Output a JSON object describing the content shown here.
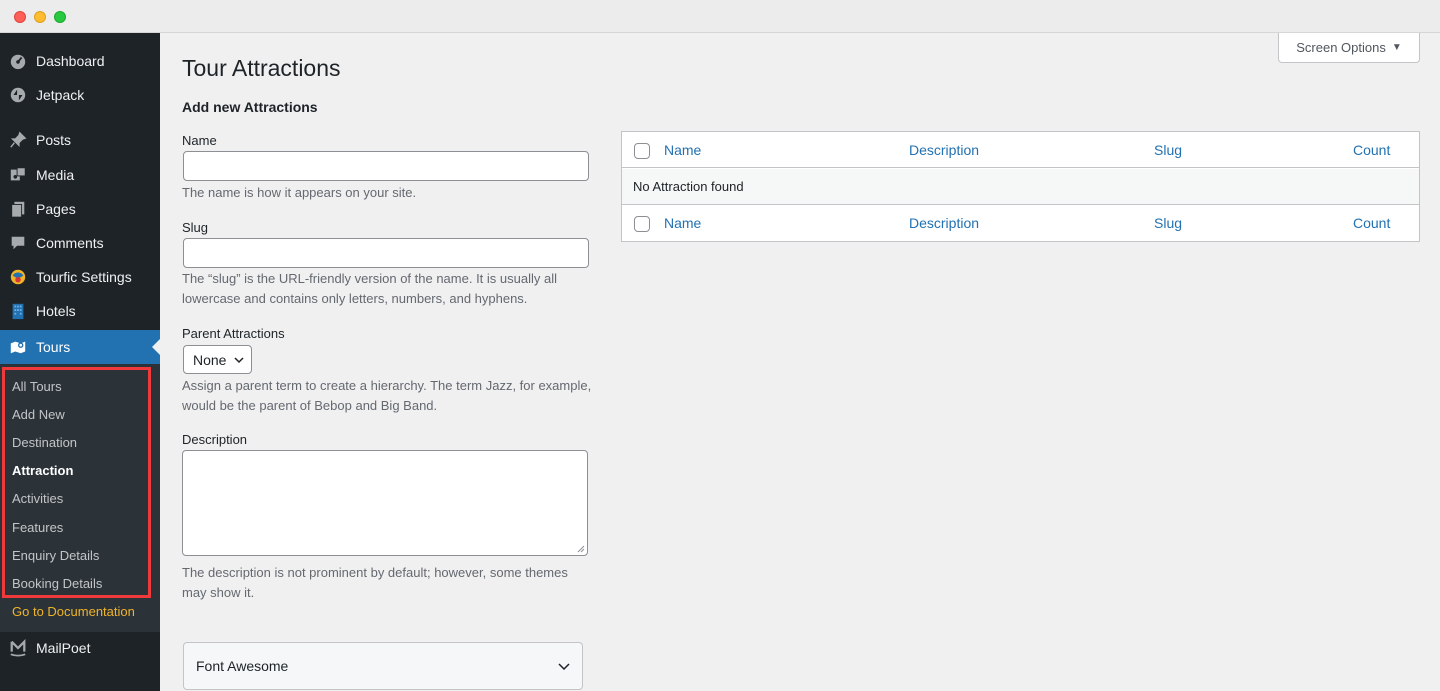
{
  "sidebar": {
    "items": [
      {
        "label": "Dashboard",
        "icon": "dashboard-icon"
      },
      {
        "label": "Jetpack",
        "icon": "jetpack-icon"
      },
      {
        "label": "Posts",
        "icon": "pin-icon"
      },
      {
        "label": "Media",
        "icon": "media-icon"
      },
      {
        "label": "Pages",
        "icon": "pages-icon"
      },
      {
        "label": "Comments",
        "icon": "comment-icon"
      },
      {
        "label": "Tourfic Settings",
        "icon": "tourfic-icon"
      },
      {
        "label": "Hotels",
        "icon": "building-icon"
      },
      {
        "label": "Tours",
        "icon": "map-icon"
      },
      {
        "label": "MailPoet",
        "icon": "mailpoet-icon"
      }
    ],
    "submenu": [
      {
        "label": "All Tours"
      },
      {
        "label": "Add New"
      },
      {
        "label": "Destination"
      },
      {
        "label": "Attraction"
      },
      {
        "label": "Activities"
      },
      {
        "label": "Features"
      },
      {
        "label": "Enquiry Details"
      },
      {
        "label": "Booking Details"
      },
      {
        "label": "Go to Documentation"
      }
    ]
  },
  "header": {
    "screen_options": "Screen Options"
  },
  "page": {
    "title": "Tour Attractions",
    "form_title": "Add new Attractions",
    "name_label": "Name",
    "name_value": "",
    "name_help": "The name is how it appears on your site.",
    "slug_label": "Slug",
    "slug_value": "",
    "slug_help": "The “slug” is the URL-friendly version of the name. It is usually all lowercase and contains only letters, numbers, and hyphens.",
    "parent_label": "Parent Attractions",
    "parent_value": "None",
    "parent_help": "Assign a parent term to create a hierarchy. The term Jazz, for example, would be the parent of Bebop and Big Band.",
    "description_label": "Description",
    "description_value": "",
    "description_help": "The description is not prominent by default; however, some themes may show it.",
    "accordion_label": "Font Awesome"
  },
  "table": {
    "columns": [
      "Name",
      "Description",
      "Slug",
      "Count"
    ],
    "empty_message": "No Attraction found"
  },
  "colors": {
    "sidebar_bg": "#1d2327",
    "submenu_bg": "#2c3338",
    "accent": "#2271b1",
    "highlight_border": "#f0393b",
    "doc_link": "#f0b429"
  }
}
